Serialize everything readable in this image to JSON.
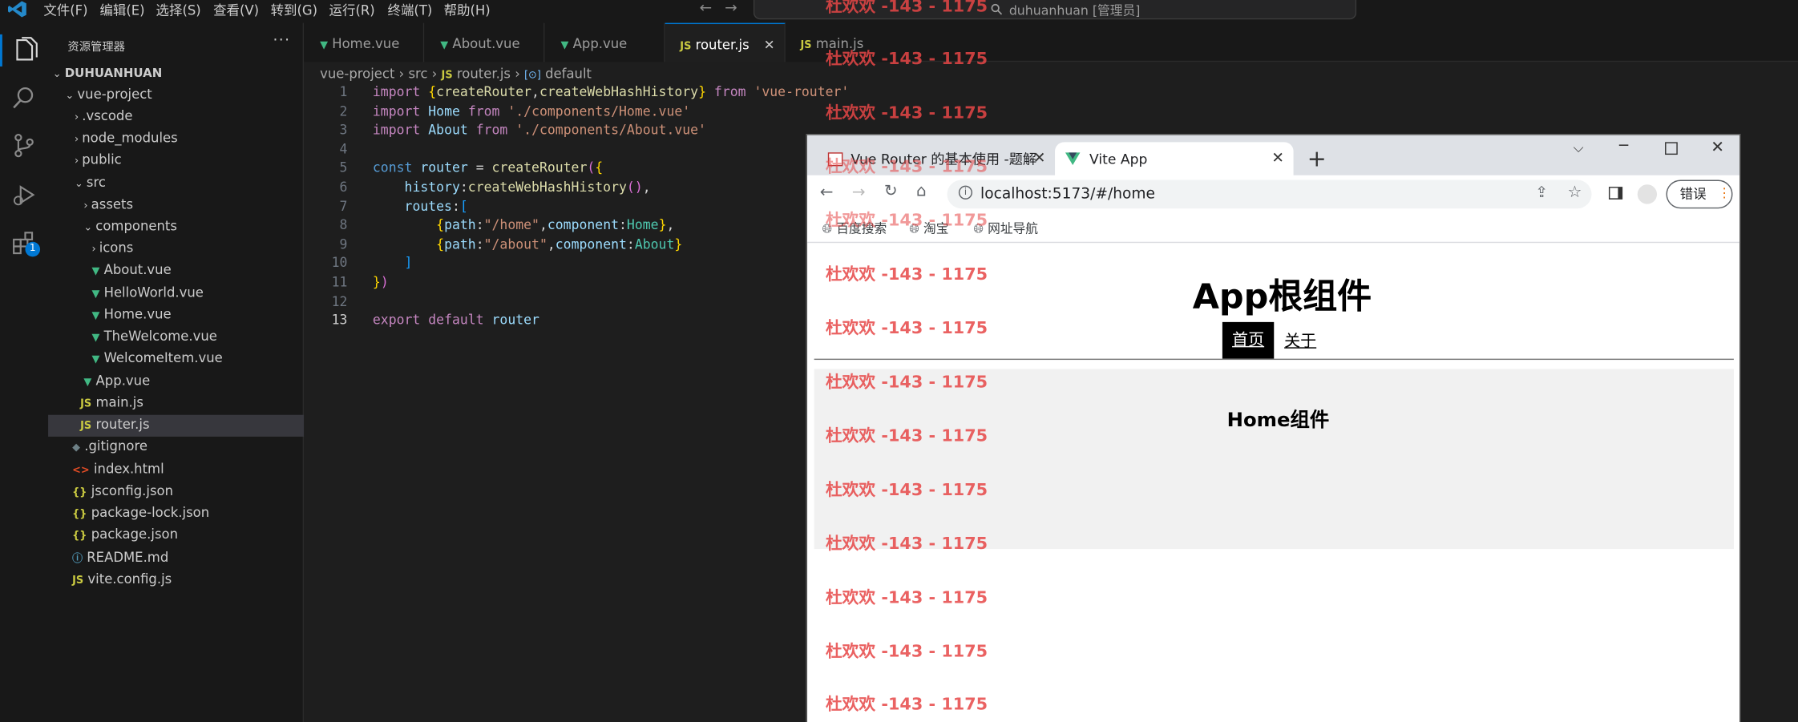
{
  "menu": [
    "文件(F)",
    "编辑(E)",
    "选择(S)",
    "查看(V)",
    "转到(G)",
    "运行(R)",
    "终端(T)",
    "帮助(H)"
  ],
  "command_center": "duhuanhuan [管理员]",
  "sidebar": {
    "title": "资源管理器",
    "workspace": "DUHUANHUAN",
    "items": [
      {
        "label": "vue-project"
      },
      {
        "label": ".vscode"
      },
      {
        "label": "node_modules"
      },
      {
        "label": "public"
      },
      {
        "label": "src"
      },
      {
        "label": "assets"
      },
      {
        "label": "components"
      },
      {
        "label": "icons"
      },
      {
        "label": "About.vue"
      },
      {
        "label": "HelloWorld.vue"
      },
      {
        "label": "Home.vue"
      },
      {
        "label": "TheWelcome.vue"
      },
      {
        "label": "WelcomeItem.vue"
      },
      {
        "label": "App.vue"
      },
      {
        "label": "main.js"
      },
      {
        "label": "router.js"
      },
      {
        "label": ".gitignore"
      },
      {
        "label": "index.html"
      },
      {
        "label": "jsconfig.json"
      },
      {
        "label": "package-lock.json"
      },
      {
        "label": "package.json"
      },
      {
        "label": "README.md"
      },
      {
        "label": "vite.config.js"
      }
    ],
    "badge": "1"
  },
  "tabs": [
    "Home.vue",
    "About.vue",
    "App.vue",
    "router.js",
    "main.js"
  ],
  "breadcrumb": [
    "vue-project",
    "src",
    "router.js",
    "default"
  ],
  "code_lines": [
    "import {createRouter,createWebHashHistory} from 'vue-router'",
    "import Home from './components/Home.vue'",
    "import About from './components/About.vue'",
    "",
    "const router = createRouter({",
    "    history:createWebHashHistory(),",
    "    routes:[",
    "        {path:\"/home\",component:Home},",
    "        {path:\"/about\",component:About}",
    "    ]",
    "})",
    "",
    "export default router"
  ],
  "line_numbers": [
    "1",
    "2",
    "3",
    "4",
    "5",
    "6",
    "7",
    "8",
    "9",
    "10",
    "11",
    "12",
    "13"
  ],
  "browser": {
    "tab1": "Vue Router 的基本使用 -题解",
    "tab2": "Vite App",
    "url": "localhost:5173/#/home",
    "bookmarks": [
      "百度搜索",
      "淘宝",
      "网址导航"
    ],
    "error_button": "错误"
  },
  "page": {
    "title": "App根组件",
    "nav_home": "首页",
    "nav_about": "关于",
    "home_heading": "Home组件"
  },
  "watermark": "杜欢欢 -143 - 1175"
}
